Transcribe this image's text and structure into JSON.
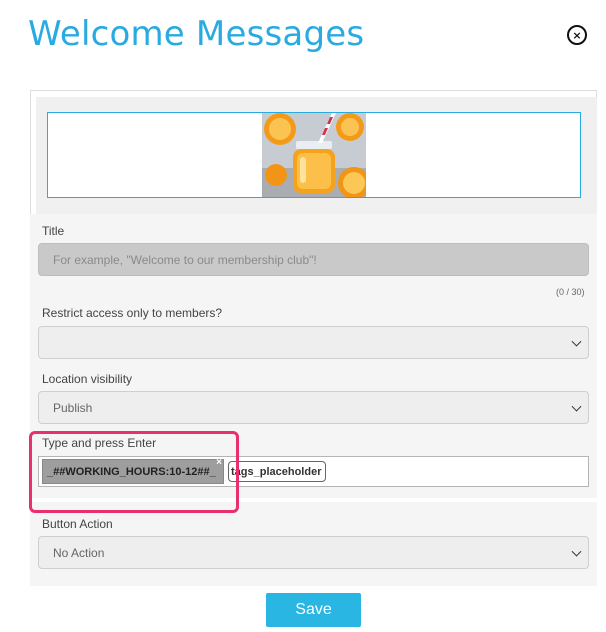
{
  "modal": {
    "title": "Welcome Messages",
    "close_label": "×"
  },
  "form": {
    "title_label": "Title",
    "title_placeholder": "For example, \"Welcome to our membership club\"!",
    "title_counter": "(0 / 30)",
    "restrict_label": "Restrict access only to members?",
    "restrict_value": "",
    "visibility_label": "Location visibility",
    "visibility_value": "Publish",
    "tags_label": "Type and press Enter",
    "tags": [
      "_##WORKING_HOURS:10-12##_"
    ],
    "tag_remove": "×",
    "tags_input_value": "tags_placeholder",
    "button_action_label": "Button Action",
    "button_action_value": "No Action"
  },
  "footer": {
    "save_label": "Save"
  },
  "colors": {
    "accent": "#29abe2",
    "highlight": "#e8306c"
  }
}
